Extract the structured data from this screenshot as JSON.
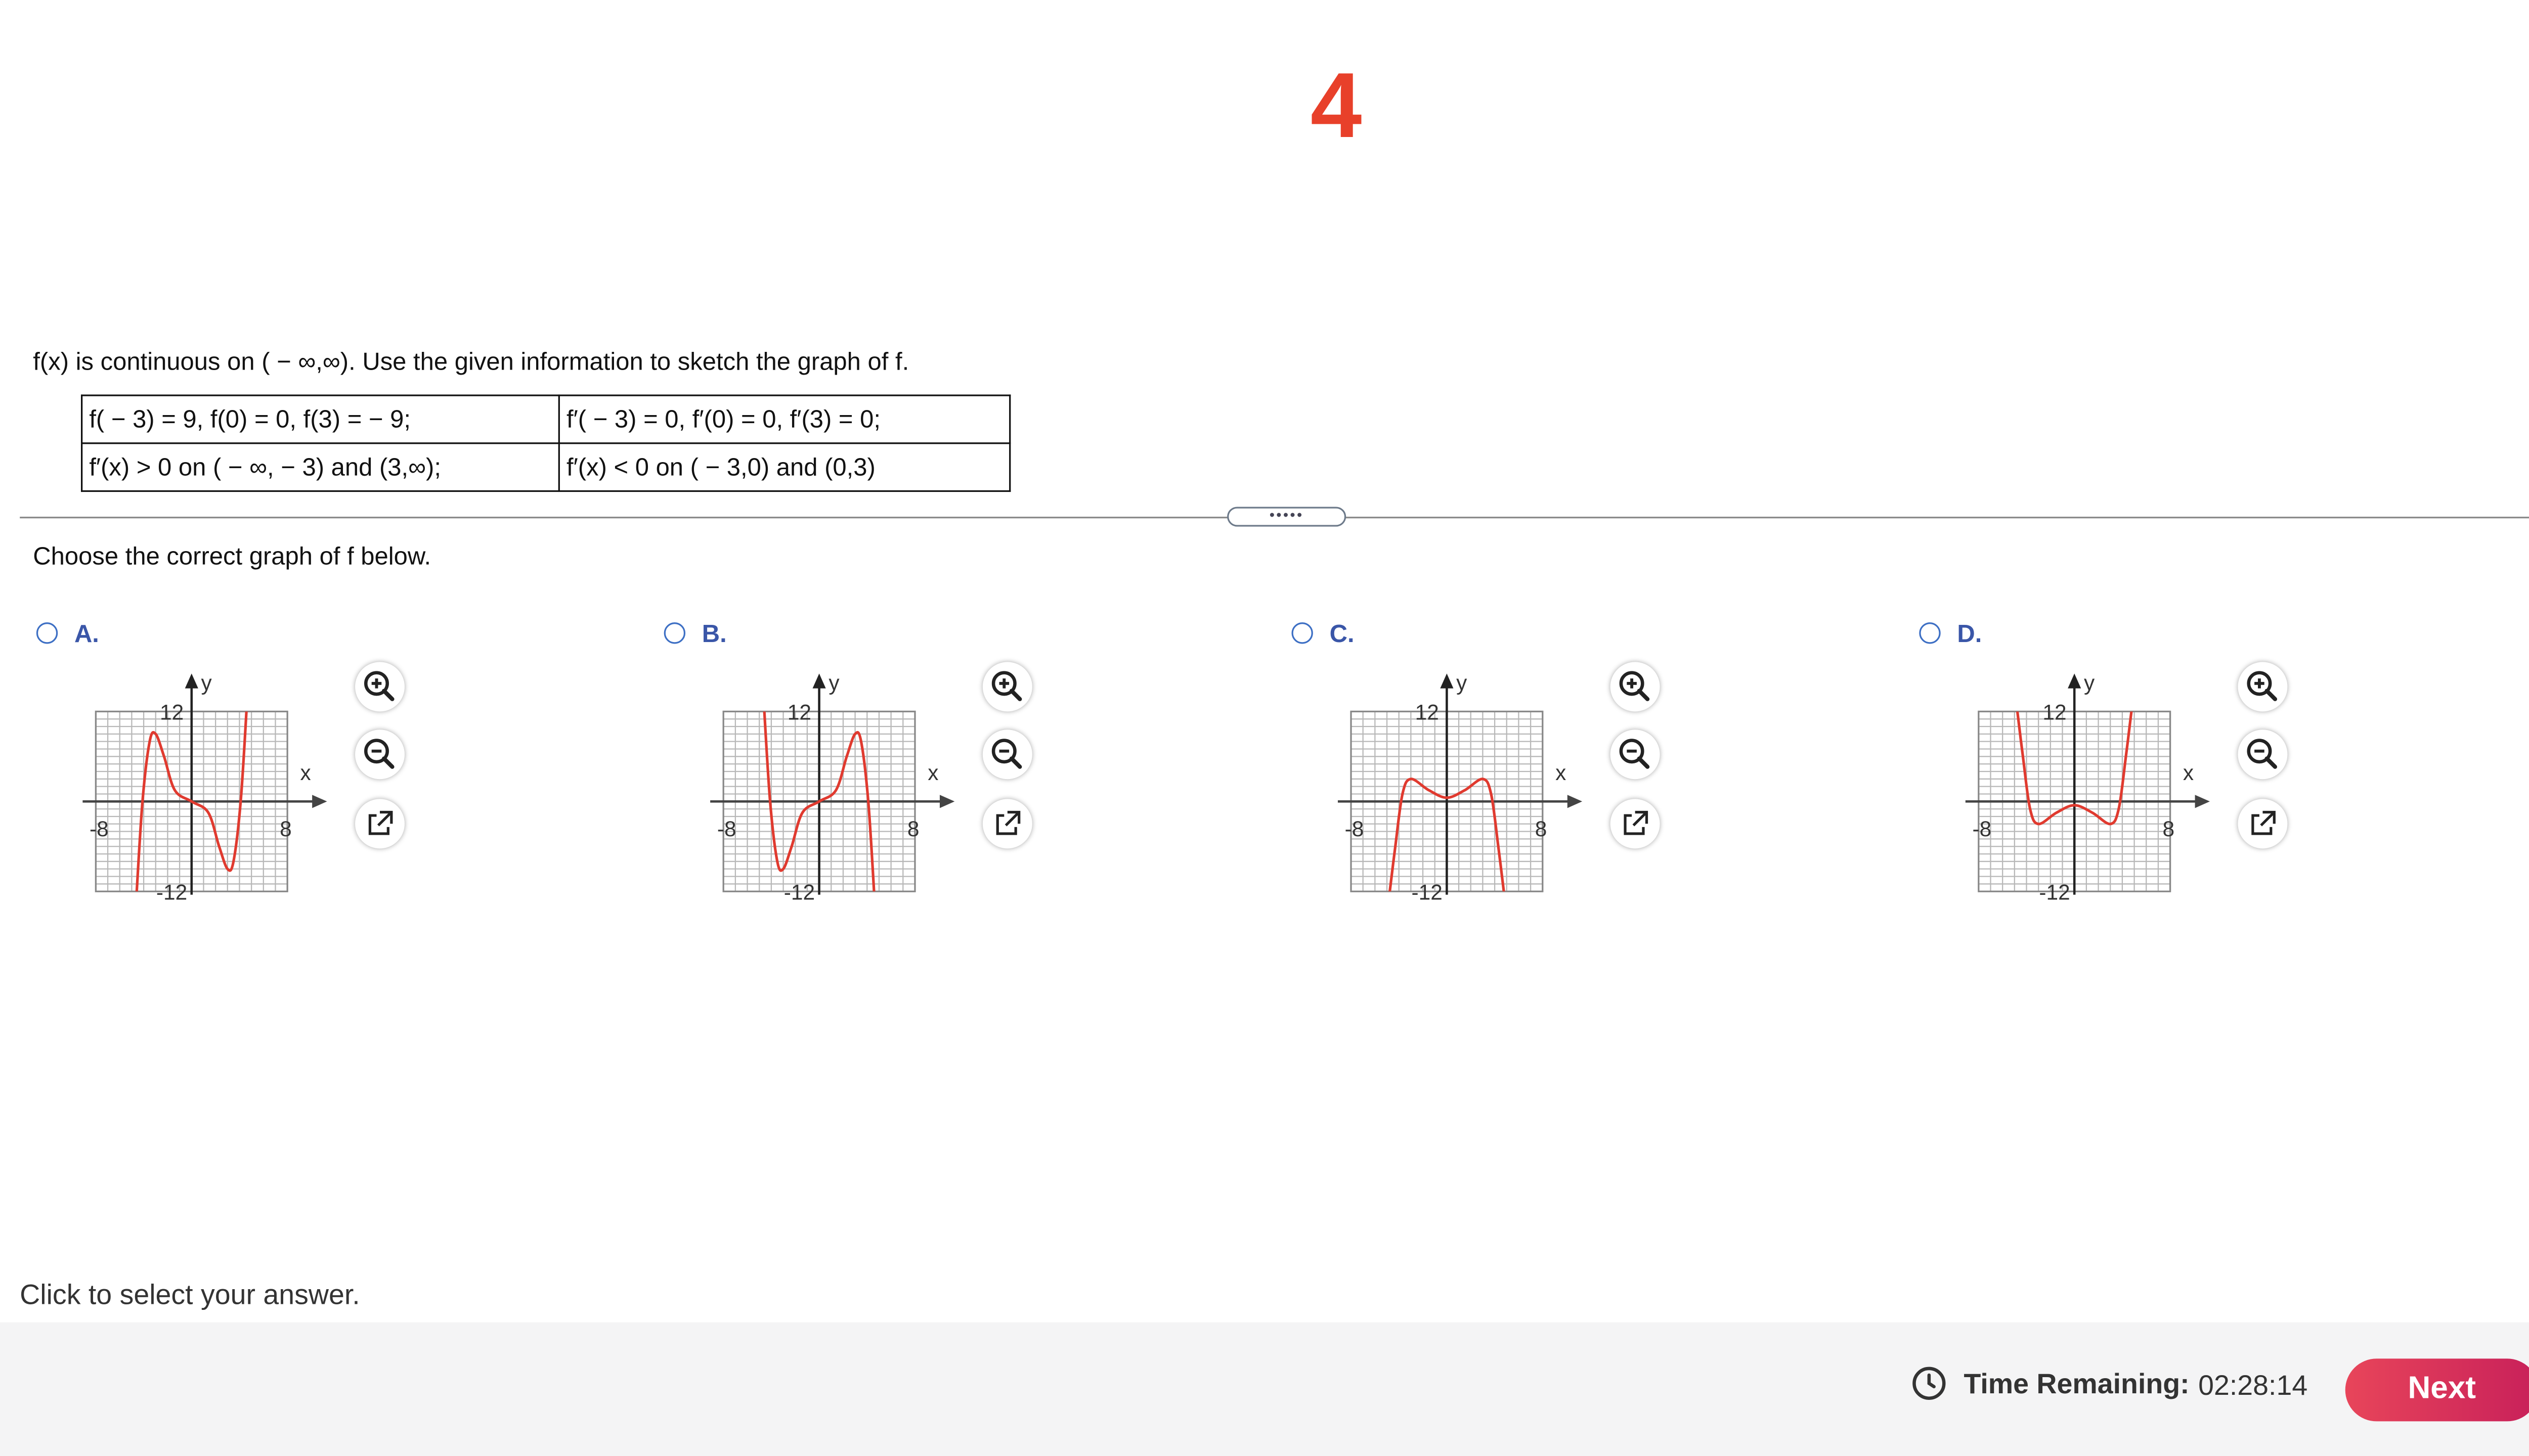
{
  "question": {
    "number": "4",
    "number_color": "#e8402a",
    "prompt": "f(x) is continuous on ( − ∞,∞).  Use the given information to sketch the graph of f.",
    "table": [
      [
        "f( − 3) = 9, f(0) = 0, f(3) =  − 9;",
        "f′( − 3) = 0, f′(0) = 0, f′(3) = 0;"
      ],
      [
        "f′(x) > 0 on ( − ∞, − 3) and (3,∞);",
        "f′(x) < 0 on ( − 3,0) and (0,3)"
      ]
    ],
    "divider_handle": "•••••",
    "instruction": "Choose the correct graph of f below."
  },
  "choices": [
    {
      "letter": "A.",
      "curve": "A"
    },
    {
      "letter": "B.",
      "curve": "B"
    },
    {
      "letter": "C.",
      "curve": "C"
    },
    {
      "letter": "D.",
      "curve": "D"
    }
  ],
  "graph_labels": {
    "y_axis": "y",
    "x_axis": "x",
    "y_max": "12",
    "y_min": "-12",
    "x_min": "-8",
    "x_max": "8"
  },
  "tool_icons": [
    "zoom-in-icon",
    "zoom-out-icon",
    "open-in-new-window-icon"
  ],
  "hint": "Click to select your answer.",
  "footer": {
    "time_label": "Time Remaining:",
    "time_value": "02:28:14",
    "next_label": "Next"
  },
  "colors": {
    "accent_blue": "#3a56a8",
    "curve_red": "#e03a2f",
    "next_button": "#d8305a"
  }
}
